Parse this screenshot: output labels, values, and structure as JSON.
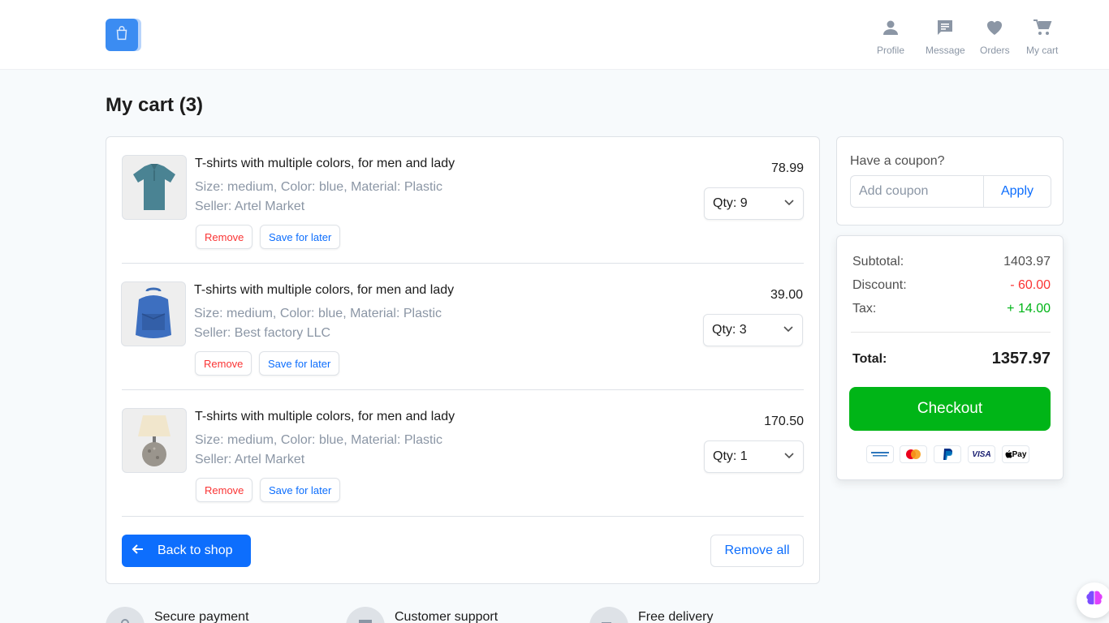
{
  "header": {
    "logo_icon": "shopping-bag-icon",
    "nav": [
      {
        "label": "Profile",
        "icon": "person-icon"
      },
      {
        "label": "Message",
        "icon": "message-icon"
      },
      {
        "label": "Orders",
        "icon": "heart-icon"
      },
      {
        "label": "My cart",
        "icon": "cart-icon"
      }
    ]
  },
  "page": {
    "title": "My cart (3)"
  },
  "cart": {
    "items": [
      {
        "title": "T-shirts with multiple colors, for men and lady",
        "details": "Size: medium, Color: blue,  Material: Plastic",
        "seller": "Seller: Artel Market",
        "price": "78.99",
        "qty": "Qty: 9",
        "remove_label": "Remove",
        "save_label": "Save for later",
        "image": "shirt-image"
      },
      {
        "title": "T-shirts with multiple colors, for men and lady",
        "details": "Size: medium, Color: blue,  Material: Plastic",
        "seller": "Seller: Best factory LLC",
        "price": "39.00",
        "qty": "Qty: 3",
        "remove_label": "Remove",
        "save_label": "Save for later",
        "image": "backpack-image"
      },
      {
        "title": "T-shirts with multiple colors, for men and lady",
        "details": "Size: medium, Color: blue,  Material: Plastic",
        "seller": "Seller: Artel Market",
        "price": "170.50",
        "qty": "Qty: 1",
        "remove_label": "Remove",
        "save_label": "Save for later",
        "image": "lamp-image"
      }
    ],
    "back_label": "Back to shop",
    "remove_all_label": "Remove all"
  },
  "coupon": {
    "label": "Have a coupon?",
    "placeholder": "Add coupon",
    "apply_label": "Apply"
  },
  "summary": {
    "subtotal_label": "Subtotal:",
    "subtotal": "1403.97",
    "discount_label": "Discount:",
    "discount": "- 60.00",
    "tax_label": "Tax:",
    "tax": "+ 14.00",
    "total_label": "Total:",
    "total": "1357.97",
    "checkout_label": "Checkout",
    "payments": [
      "amex-icon",
      "mastercard-icon",
      "paypal-icon",
      "visa-icon",
      "apple-pay-icon"
    ],
    "visa_text": "VISA",
    "applepay_text": "Pay"
  },
  "features": [
    {
      "label": "Secure payment",
      "icon": "lock-icon"
    },
    {
      "label": "Customer support",
      "icon": "message-icon"
    },
    {
      "label": "Free delivery",
      "icon": "truck-icon"
    }
  ],
  "colors": {
    "primary": "#0d6efd",
    "danger": "#fa3434",
    "success": "#00b517",
    "muted": "#8b96a5"
  }
}
